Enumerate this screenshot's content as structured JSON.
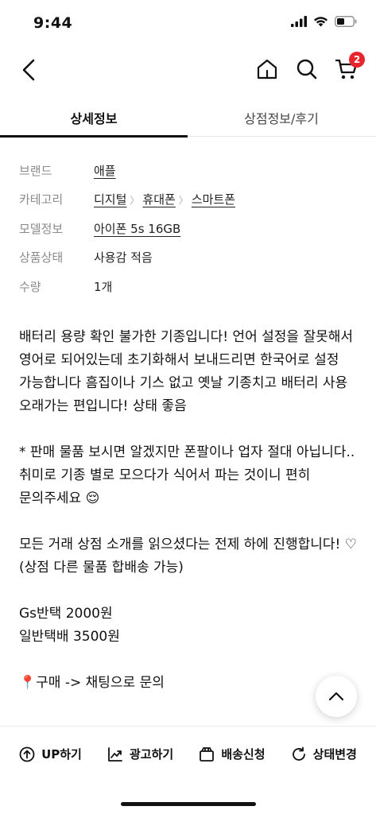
{
  "status_bar": {
    "time": "9:44"
  },
  "nav": {
    "cart_count": "2"
  },
  "tabs": [
    {
      "label": "상세정보",
      "active": true
    },
    {
      "label": "상점정보/후기",
      "active": false
    }
  ],
  "info": {
    "brand": {
      "label": "브랜드",
      "value": "애플"
    },
    "category": {
      "label": "카테고리",
      "items": [
        "디지털",
        "휴대폰",
        "스마트폰"
      ]
    },
    "model": {
      "label": "모델정보",
      "value": "아이폰 5s 16GB"
    },
    "condition": {
      "label": "상품상태",
      "value": "사용감 적음"
    },
    "quantity": {
      "label": "수량",
      "value": "1개"
    }
  },
  "description": [
    "배터리 용량 확인 불가한 기종입니다! 언어 설정을 잘못해서 영어로 되어있는데 초기화해서 보내드리면 한국어로 설정 가능합니다 흠집이나 기스 없고 옛날 기종치고 배터리 사용 오래가는 편입니다! 상태 좋음",
    "* 판매 물품 보시면 알겠지만 폰팔이나 업자 절대 아닙니다.. 취미로 기종 별로 모으다가 식어서 파는 것이니 편히 문의주세요 😌",
    "모든 거래 상점 소개를 읽으셨다는 전제 하에 진행합니다! ♡ (상점 다른 물품 합배송 가능)",
    "Gs반택 2000원\n일반택배 3500원",
    "📍구매 -> 채팅으로 문의"
  ],
  "bottom_bar": [
    {
      "label": "UP하기",
      "icon": "arrow-up-circle-icon"
    },
    {
      "label": "광고하기",
      "icon": "trending-up-icon"
    },
    {
      "label": "배송신청",
      "icon": "package-icon"
    },
    {
      "label": "상태변경",
      "icon": "refresh-icon"
    }
  ],
  "colors": {
    "accent_badge": "#e8242c",
    "label_gray": "#8a8a8a"
  }
}
